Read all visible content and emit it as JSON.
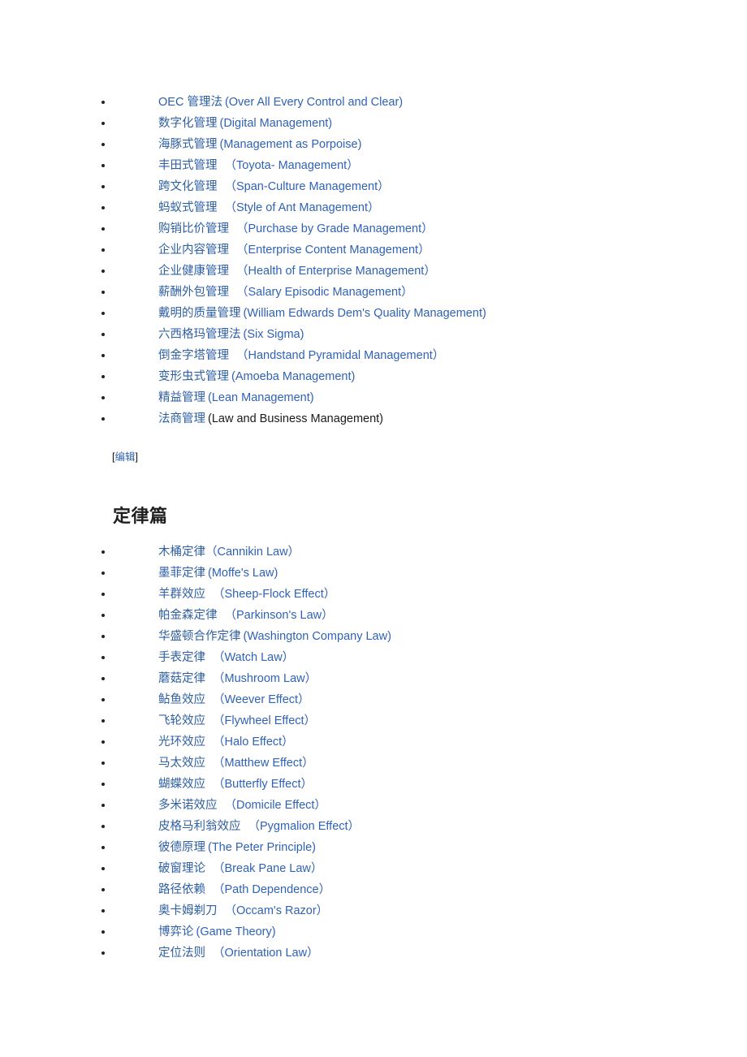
{
  "page": {
    "background_color": "#ffffff",
    "link_color": "#2e5fa3",
    "text_color": "#1a1a1a",
    "heading_color": "#1f1f1f"
  },
  "management_list": {
    "items": [
      {
        "cn": "OEC 管理法",
        "en": "(Over All Every Control and Clear)",
        "en_plain": false,
        "gap": "sm"
      },
      {
        "cn": "数字化管理",
        "en": "(Digital Management)",
        "en_plain": false,
        "gap": "sm"
      },
      {
        "cn": "海豚式管理",
        "en": "(Management as Porpoise)",
        "en_plain": false,
        "gap": "sm"
      },
      {
        "cn": "丰田式管理",
        "en": "（Toyota- Management）",
        "en_plain": false,
        "gap": "md"
      },
      {
        "cn": "跨文化管理",
        "en": "（Span-Culture Management）",
        "en_plain": false,
        "gap": "md"
      },
      {
        "cn": "蚂蚁式管理",
        "en": "（Style of Ant Management）",
        "en_plain": false,
        "gap": "md"
      },
      {
        "cn": "购销比价管理",
        "en": "（Purchase by Grade Management）",
        "en_plain": false,
        "gap": "md"
      },
      {
        "cn": "企业内容管理",
        "en": "（Enterprise Content Management）",
        "en_plain": false,
        "gap": "md"
      },
      {
        "cn": "企业健康管理",
        "en": "（Health of Enterprise Management）",
        "en_plain": false,
        "gap": "md"
      },
      {
        "cn": "薪酬外包管理",
        "en": "（Salary Episodic Management）",
        "en_plain": false,
        "gap": "md"
      },
      {
        "cn": "戴明的质量管理",
        "en": "(William Edwards Dem's Quality Management)",
        "en_plain": false,
        "gap": "sm"
      },
      {
        "cn": "六西格玛管理法",
        "en": "(Six Sigma)",
        "en_plain": false,
        "gap": "sm"
      },
      {
        "cn": "倒金字塔管理",
        "en": "（Handstand Pyramidal Management）",
        "en_plain": false,
        "gap": "md"
      },
      {
        "cn": "变形虫式管理",
        "en": "(Amoeba Management)",
        "en_plain": false,
        "gap": "sm"
      },
      {
        "cn": "精益管理",
        "en": "(Lean Management)",
        "en_plain": false,
        "gap": "sm"
      },
      {
        "cn": "法商管理",
        "en": "(Law and Business Management)",
        "en_plain": true,
        "gap": "sm"
      }
    ]
  },
  "edit_marker": {
    "open_bracket": "[",
    "label": "编辑",
    "close_bracket": "]"
  },
  "heading": {
    "title": "定律篇"
  },
  "law_list": {
    "items": [
      {
        "cn": "木桶定律",
        "en": "（Cannikin Law）",
        "en_plain": false,
        "gap": "none"
      },
      {
        "cn": "墨菲定律",
        "en": "(Moffe's Law)",
        "en_plain": false,
        "gap": "sm"
      },
      {
        "cn": "羊群效应",
        "en": "（Sheep-Flock Effect）",
        "en_plain": false,
        "gap": "md"
      },
      {
        "cn": "帕金森定律",
        "en": "（Parkinson's Law）",
        "en_plain": false,
        "gap": "md"
      },
      {
        "cn": "华盛顿合作定律",
        "en": "(Washington Company Law)",
        "en_plain": false,
        "gap": "sm"
      },
      {
        "cn": "手表定律",
        "en": "（Watch Law）",
        "en_plain": false,
        "gap": "md"
      },
      {
        "cn": "蘑菇定律",
        "en": "（Mushroom Law）",
        "en_plain": false,
        "gap": "md"
      },
      {
        "cn": "鲇鱼效应",
        "en": "（Weever Effect）",
        "en_plain": false,
        "gap": "md"
      },
      {
        "cn": "飞轮效应",
        "en": "（Flywheel Effect）",
        "en_plain": false,
        "gap": "md"
      },
      {
        "cn": "光环效应",
        "en": "（Halo Effect）",
        "en_plain": false,
        "gap": "md"
      },
      {
        "cn": "马太效应",
        "en": "（Matthew Effect）",
        "en_plain": false,
        "gap": "md"
      },
      {
        "cn": "蝴蝶效应",
        "en": "（Butterfly Effect）",
        "en_plain": false,
        "gap": "md"
      },
      {
        "cn": "多米诺效应",
        "en": "（Domicile Effect）",
        "en_plain": false,
        "gap": "md"
      },
      {
        "cn": "皮格马利翁效应",
        "en": "（Pygmalion Effect）",
        "en_plain": false,
        "gap": "md"
      },
      {
        "cn": "彼德原理",
        "en": "(The Peter Principle)",
        "en_plain": false,
        "gap": "sm"
      },
      {
        "cn": "破窗理论",
        "en": "（Break Pane Law）",
        "en_plain": false,
        "gap": "md"
      },
      {
        "cn": "路径依赖",
        "en": "（Path Dependence）",
        "en_plain": false,
        "gap": "md"
      },
      {
        "cn": "奥卡姆剃刀",
        "en": "（Occam's Razor）",
        "en_plain": false,
        "gap": "md"
      },
      {
        "cn": "博弈论",
        "en": "(Game Theory)",
        "en_plain": false,
        "gap": "sm"
      },
      {
        "cn": "定位法则",
        "en": "（Orientation Law）",
        "en_plain": false,
        "gap": "md"
      }
    ]
  }
}
